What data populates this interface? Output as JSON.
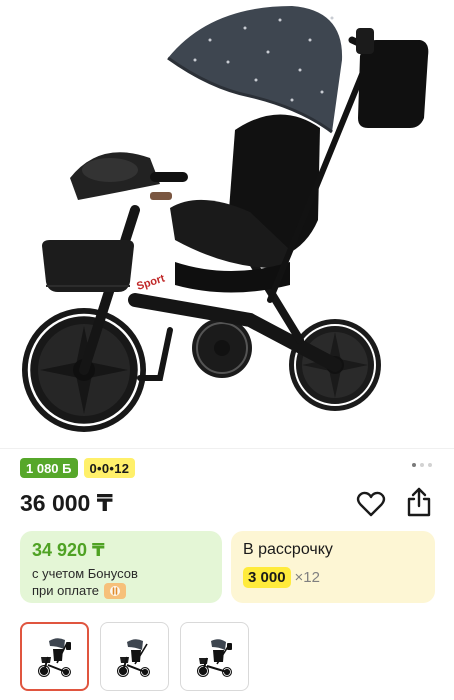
{
  "product": {
    "image_name": "kids-tricycle-with-canopy",
    "badges": {
      "bonus": "1 080 Б",
      "installment_code": "0•0•12"
    },
    "gallery_position": {
      "current": 1,
      "total": 3
    },
    "price": "36 000 ₸",
    "bonus_card": {
      "price": "34 920 ₸",
      "note_line1": "с учетом Бонусов",
      "note_line2": "при оплате"
    },
    "installment_card": {
      "title": "В рассрочку",
      "amount": "3 000",
      "times": "×12"
    },
    "thumbnails": [
      "tricycle-view-1",
      "tricycle-view-2",
      "tricycle-view-3"
    ]
  },
  "icons": [
    "heart-icon",
    "share-icon",
    "bonus-logo-icon"
  ],
  "colors": {
    "bonus_green": "#56a72a",
    "bonus_card_bg": "#e4f6d6",
    "installment_yellow": "#ffeb3b",
    "installment_card_bg": "#fdf6d4",
    "selected_thumb_border": "#e0553f"
  }
}
